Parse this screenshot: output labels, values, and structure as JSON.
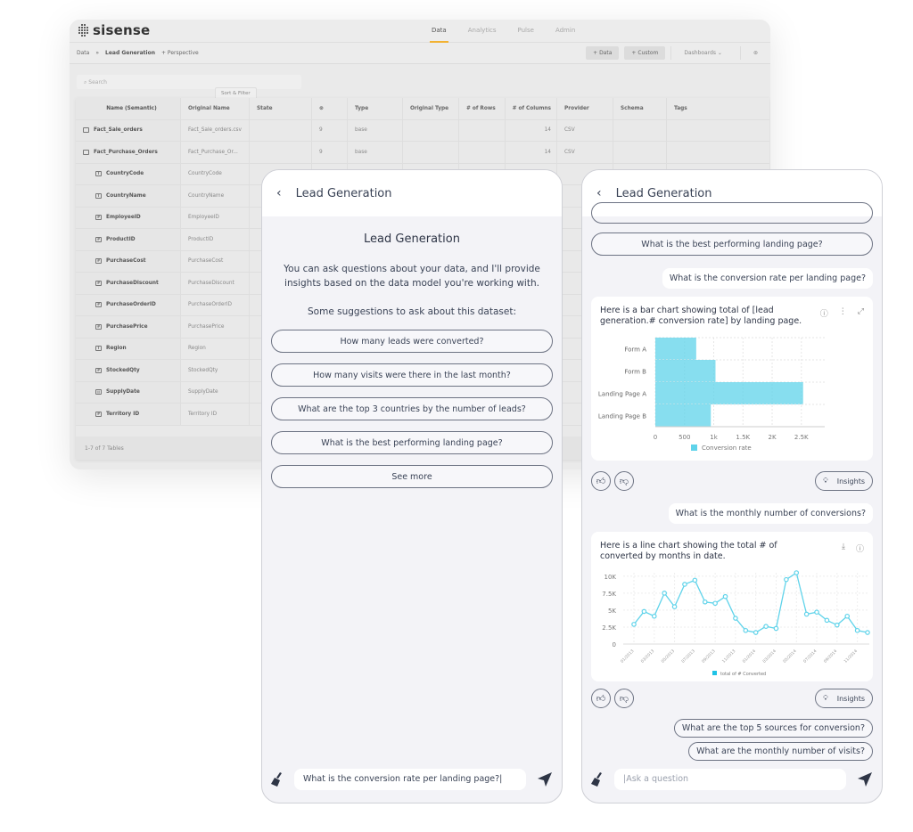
{
  "app": {
    "logo": "sisense",
    "nav_tabs": [
      "Data",
      "Analytics",
      "Pulse",
      "Admin"
    ],
    "active_tab": "Data",
    "breadcrumb": {
      "root": "Data",
      "separator": "»",
      "current": "Lead Generation",
      "perspective": "+ Perspective"
    },
    "toolbar": {
      "add_data": "+ Data",
      "add_custom": "+ Custom",
      "dashboards": "Dashboards ⌄"
    },
    "search_placeholder": "Search",
    "tooltip": "Sort & Filter",
    "table": {
      "columns": [
        "Name (Semantic)",
        "Original Name",
        "State",
        "⊛",
        "Type",
        "Original Type",
        "# of Rows",
        "# of Columns",
        "Provider",
        "Schema",
        "Tags"
      ],
      "tables": [
        {
          "name": "Fact_Sale_orders",
          "original": "Fact_Sale_orders.csv",
          "count": "9",
          "type": "base",
          "columns": "14",
          "provider": "CSV"
        },
        {
          "name": "Fact_Purchase_Orders",
          "original": "Fact_Purchase_Or...",
          "count": "9",
          "type": "base",
          "columns": "14",
          "provider": "CSV"
        }
      ],
      "fields": [
        {
          "name": "CountryCode",
          "original": "CountryCode",
          "icon": "text"
        },
        {
          "name": "CountryName",
          "original": "CountryName",
          "icon": "text"
        },
        {
          "name": "EmployeeID",
          "original": "EmployeeID",
          "icon": "number"
        },
        {
          "name": "ProductID",
          "original": "ProductID",
          "icon": "number"
        },
        {
          "name": "PurchaseCost",
          "original": "PurchaseCost",
          "icon": "number"
        },
        {
          "name": "PurchaseDiscount",
          "original": "PurchaseDiscount",
          "icon": "number"
        },
        {
          "name": "PurchaseOrderID",
          "original": "PurchaseOrderID",
          "icon": "number"
        },
        {
          "name": "PurchasePrice",
          "original": "PurchasePrice",
          "icon": "number"
        },
        {
          "name": "Region",
          "original": "Region",
          "icon": "text"
        },
        {
          "name": "StockedQty",
          "original": "StockedQty",
          "icon": "number"
        },
        {
          "name": "SupplyDate",
          "original": "SupplyDate",
          "icon": "date"
        },
        {
          "name": "Territory ID",
          "original": "Territory ID",
          "icon": "number"
        }
      ],
      "footer": "1-7 of 7 Tables"
    }
  },
  "left_phone": {
    "header_title": "Lead Generation",
    "welcome_title": "Lead Generation",
    "welcome_text": "You can ask questions about your data, and I'll provide insights based on the data model you're working with.",
    "welcome_sub": "Some suggestions to ask about this dataset:",
    "suggestions": [
      "How many leads were converted?",
      "How many visits were there in the last month?",
      "What are the top 3 countries by the number of leads?",
      "What is the best performing landing page?",
      "See more"
    ],
    "input_value": "What is the conversion rate per landing page?|"
  },
  "right_phone": {
    "header_title": "Lead Generation",
    "suggestion_top": "What is the best performing landing page?",
    "user_msg_1": "What is the conversion rate per landing page?",
    "bar_card_text": "Here is a bar chart showing total of [lead generation.# conversion rate] by landing page.",
    "insights_label": "Insights",
    "user_msg_2": "What is the monthly number of conversions?",
    "line_card_text": "Here is a line chart showing the total # of converted by months in date.",
    "followups": [
      "What are the top 5 sources for conversion?",
      "What are the monthly number of visits?"
    ],
    "input_placeholder": "|Ask a question"
  },
  "colors": {
    "accent": "#f2b232",
    "chart": "#5fd3ea",
    "text": "#3a4356"
  },
  "chart_data": [
    {
      "type": "bar",
      "orientation": "horizontal",
      "categories": [
        "Form A",
        "Form B",
        "Landing Page A",
        "Landing Page B"
      ],
      "series": [
        {
          "name": "Conversion rate",
          "values": [
            700,
            1030,
            2530,
            950
          ]
        }
      ],
      "xlim": [
        0,
        2900
      ],
      "xticks": [
        "0",
        "500",
        "1k",
        "1.5K",
        "2K",
        "2.5K"
      ],
      "legend": "bottom",
      "grid": true
    },
    {
      "type": "line",
      "x": [
        "01/2013",
        "02/2013",
        "03/2013",
        "04/2013",
        "05/2013",
        "06/2013",
        "07/2013",
        "08/2013",
        "09/2013",
        "10/2013",
        "11/2013",
        "12/2013",
        "01/2014",
        "02/2014",
        "03/2014",
        "04/2014",
        "05/2014",
        "06/2014",
        "07/2014",
        "08/2014",
        "09/2014",
        "10/2014",
        "11/2014",
        "12/2014"
      ],
      "xtick_labels": [
        "01/2013",
        "03/2013",
        "05/2013",
        "07/2013",
        "09/2013",
        "11/2013",
        "01/2014",
        "03/2014",
        "05/2014",
        "07/2014",
        "09/2014",
        "11/2014"
      ],
      "series": [
        {
          "name": "total of # Converted",
          "values": [
            2900,
            4800,
            4100,
            7500,
            5500,
            8800,
            9400,
            6200,
            6000,
            7000,
            3800,
            2000,
            1700,
            2600,
            2300,
            9500,
            10500,
            4400,
            4700,
            3500,
            2800,
            4100,
            2000,
            1700
          ]
        }
      ],
      "ylim": [
        0,
        10500
      ],
      "yticks": [
        "0",
        "2.5K",
        "5K",
        "7.5K",
        "10K"
      ],
      "legend": "bottom",
      "grid": true
    }
  ]
}
